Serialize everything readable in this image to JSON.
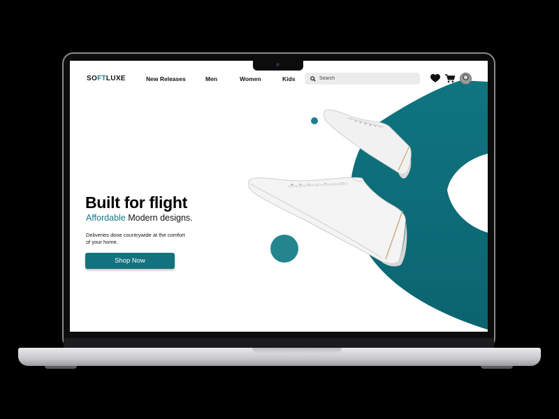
{
  "nav": {
    "logo_prefix": "SO",
    "logo_accent": "FT",
    "logo_suffix": "LUXE",
    "links": [
      "New Releases",
      "Men",
      "Women",
      "Kids"
    ],
    "search_placeholder": "Search"
  },
  "hero": {
    "title": "Built for flight",
    "subtitle_accent": "Affordable",
    "subtitle_rest": " Modern designs.",
    "description": "Deliveries done countrywide at the comfort of your home.",
    "cta_label": "Shop Now"
  },
  "icons": [
    "search-icon",
    "heart-icon",
    "cart-icon",
    "avatar"
  ],
  "colors": {
    "accent": "#127a86",
    "blob": "#0e6b76",
    "button": "#13727d"
  }
}
